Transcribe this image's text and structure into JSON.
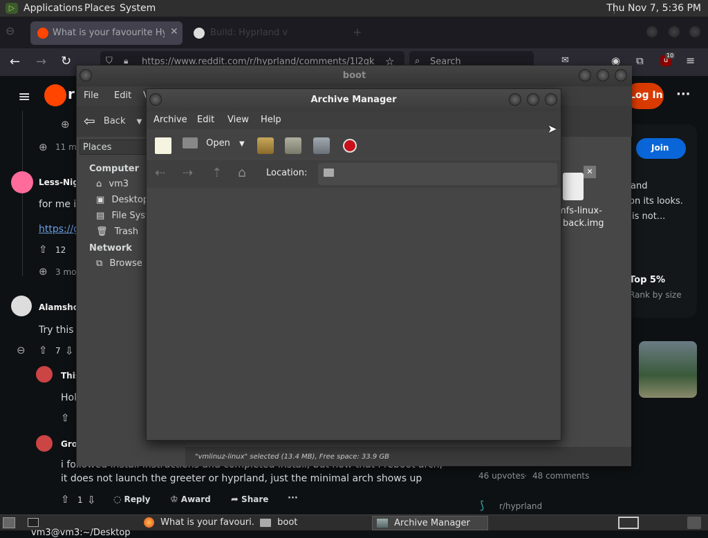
{
  "top_panel": {
    "menus": [
      "Applications",
      "Places",
      "System"
    ],
    "clock": "Thu Nov  7,  5:36 PM"
  },
  "browser": {
    "tabs": [
      {
        "title": "What is your favourite Hypr"
      },
      {
        "title": "Build: Hyprland v"
      }
    ],
    "url": "https://www.reddit.com/r/hyprland/comments/1l2gk",
    "search_placeholder": "Search",
    "extension_badge": "10"
  },
  "reddit": {
    "login_label": "Log In",
    "join_label": "Join",
    "comments": [
      {
        "meta": "11 mo"
      },
      {
        "user": "Less-Nigh",
        "text": "for me its",
        "link": "https://gi",
        "votes": "12",
        "meta": "3 mo"
      },
      {
        "user": "Alamshov",
        "text": "Try this c",
        "votes": "7"
      },
      {
        "user": "This",
        "text": "Holy"
      },
      {
        "user": "Grov",
        "text": "i followed install instructions and completed install, but now that i reboot arch, it does not launch the greeter or hyprland, just the minimal arch shows up",
        "votes": "1",
        "reply": "Reply",
        "award": "Award",
        "share": "Share"
      }
    ],
    "sidebar": {
      "snippets": [
        "and",
        "on its looks.",
        "is not..."
      ],
      "rank_title": "Top 5%",
      "rank_sub": "Rank by size",
      "upvotes": "46 upvotes",
      "comments_count": "48 comments",
      "subreddit": "r/hyprland"
    }
  },
  "boot_window": {
    "title": "boot",
    "menus": [
      "File",
      "Edit",
      "V"
    ],
    "back_label": "Back",
    "places_label": "Places",
    "sections": [
      {
        "heading": "Computer",
        "items": [
          {
            "label": "vm3",
            "icon": "home-folder-icon"
          },
          {
            "label": "Desktop",
            "icon": "desktop-folder-icon"
          },
          {
            "label": "File Syst",
            "icon": "filesystem-icon"
          },
          {
            "label": "Trash",
            "icon": "trash-icon"
          }
        ]
      },
      {
        "heading": "Network",
        "items": [
          {
            "label": "Browse N",
            "icon": "network-icon"
          }
        ]
      }
    ],
    "file": {
      "name_line1": "mfs-linux-",
      "name_line2": "back.img"
    },
    "status": "\"vmlinuz-linux\" selected (13.4 MB), Free space: 33.9 GB"
  },
  "archive_manager": {
    "title": "Archive Manager",
    "menus": [
      "Archive",
      "Edit",
      "View",
      "Help"
    ],
    "open_label": "Open",
    "location_label": "Location:"
  },
  "taskbar": {
    "items": [
      {
        "label": "vm3@vm3:~/Desktop",
        "icon": "terminal-icon"
      },
      {
        "label": "What is your favouri...",
        "icon": "firefox-icon"
      },
      {
        "label": "boot",
        "icon": "folder-icon"
      },
      {
        "label": "Archive Manager",
        "icon": "archive-icon",
        "active": true
      }
    ]
  },
  "colors": {
    "reddit_orange": "#ff4500",
    "join_blue": "#0a66d8",
    "stop_red": "#c8101a"
  }
}
